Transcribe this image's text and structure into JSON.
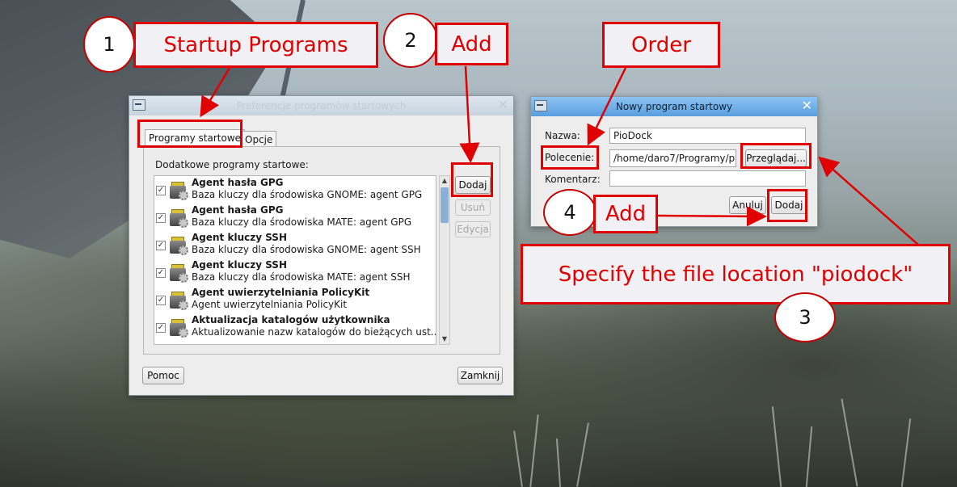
{
  "colors": {
    "annotation_red": "#e00000"
  },
  "annotations": {
    "step1_number": "1",
    "step1_label": "Startup Programs",
    "step2_number": "2",
    "step2_label": "Add",
    "order_label": "Order",
    "step3_label": "Specify the file location \"piodock\"",
    "step3_number": "3",
    "step4_number": "4",
    "step4_label": "Add"
  },
  "startup_window": {
    "title": "Preferencje programów startowych",
    "tabs": [
      {
        "label": "Programy startowe",
        "active": true
      },
      {
        "label": "Opcje",
        "active": false
      }
    ],
    "list_heading": "Dodatkowe programy startowe:",
    "items": [
      {
        "name": "Agent hasła GPG",
        "description": "Baza kluczy dla środowiska GNOME: agent GPG",
        "checked": true
      },
      {
        "name": "Agent hasła GPG",
        "description": "Baza kluczy dla środowiska MATE: agent GPG",
        "checked": true
      },
      {
        "name": "Agent kluczy SSH",
        "description": "Baza kluczy dla środowiska GNOME: agent SSH",
        "checked": true
      },
      {
        "name": "Agent kluczy SSH",
        "description": "Baza kluczy dla środowiska MATE: agent SSH",
        "checked": true
      },
      {
        "name": "Agent uwierzytelniania PolicyKit",
        "description": "Agent uwierzytelniania PolicyKit",
        "checked": true
      },
      {
        "name": "Aktualizacja katalogów użytkownika",
        "description": "Aktualizowanie nazw katalogów do bieżących ust...",
        "checked": true
      }
    ],
    "buttons": {
      "add": "Dodaj",
      "remove": "Usuń",
      "edit": "Edycja",
      "help": "Pomoc",
      "close": "Zamknij"
    }
  },
  "new_program_window": {
    "title": "Nowy program startowy",
    "name_label": "Nazwa:",
    "name_value": "PioDock",
    "command_label": "Polecenie:",
    "command_value": "/home/daro7/Programy/p",
    "browse": "Przeglądaj...",
    "comment_label": "Komentarz:",
    "comment_value": "",
    "cancel": "Anuluj",
    "add": "Dodaj"
  }
}
